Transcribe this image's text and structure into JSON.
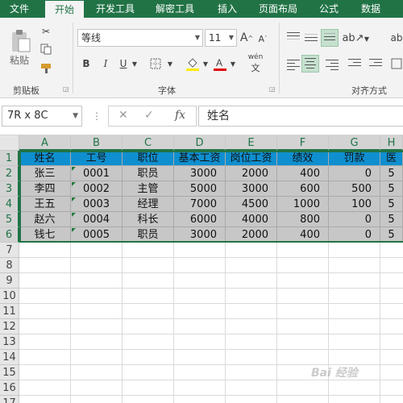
{
  "tabs": [
    {
      "label": "文件",
      "active": false
    },
    {
      "label": "开始",
      "active": true
    },
    {
      "label": "开发工具",
      "active": false
    },
    {
      "label": "解密工具",
      "active": false
    },
    {
      "label": "插入",
      "active": false
    },
    {
      "label": "页面布局",
      "active": false
    },
    {
      "label": "公式",
      "active": false
    },
    {
      "label": "数据",
      "active": false
    }
  ],
  "ribbon": {
    "clipboard": {
      "paste_label": "粘贴",
      "group_label": "剪贴板"
    },
    "font": {
      "font_name": "等线",
      "font_size": "11",
      "bold": "B",
      "italic": "I",
      "underline": "U",
      "grow": "A",
      "shrink": "A",
      "phonetic": "wén",
      "group_label": "字体"
    },
    "alignment": {
      "group_label": "对齐方式"
    }
  },
  "formula_bar": {
    "name_box": "7R x 8C",
    "fx": "fx",
    "value": "姓名"
  },
  "sheet": {
    "columns": [
      "A",
      "B",
      "C",
      "D",
      "E",
      "F",
      "G",
      "H"
    ],
    "rows": [
      "1",
      "2",
      "3",
      "4",
      "5",
      "6",
      "7",
      "8",
      "9",
      "10",
      "11",
      "12",
      "13",
      "14",
      "15",
      "16",
      "17"
    ],
    "header": [
      "姓名",
      "工号",
      "职位",
      "基本工资",
      "岗位工资",
      "绩效",
      "罚款",
      "医"
    ],
    "data": [
      [
        "张三",
        "0001",
        "职员",
        "3000",
        "2000",
        "400",
        "0",
        "5"
      ],
      [
        "李四",
        "0002",
        "主管",
        "5000",
        "3000",
        "600",
        "500",
        "5"
      ],
      [
        "王五",
        "0003",
        "经理",
        "7000",
        "4500",
        "1000",
        "100",
        "5"
      ],
      [
        "赵六",
        "0004",
        "科长",
        "6000",
        "4000",
        "800",
        "0",
        "5"
      ],
      [
        "钱七",
        "0005",
        "职员",
        "3000",
        "2000",
        "400",
        "0",
        "5"
      ]
    ]
  },
  "colors": {
    "accent": "#217346",
    "header_fill": "#0f8fd0",
    "body_fill": "#c7c7c7"
  },
  "watermark": "Bai 经验"
}
